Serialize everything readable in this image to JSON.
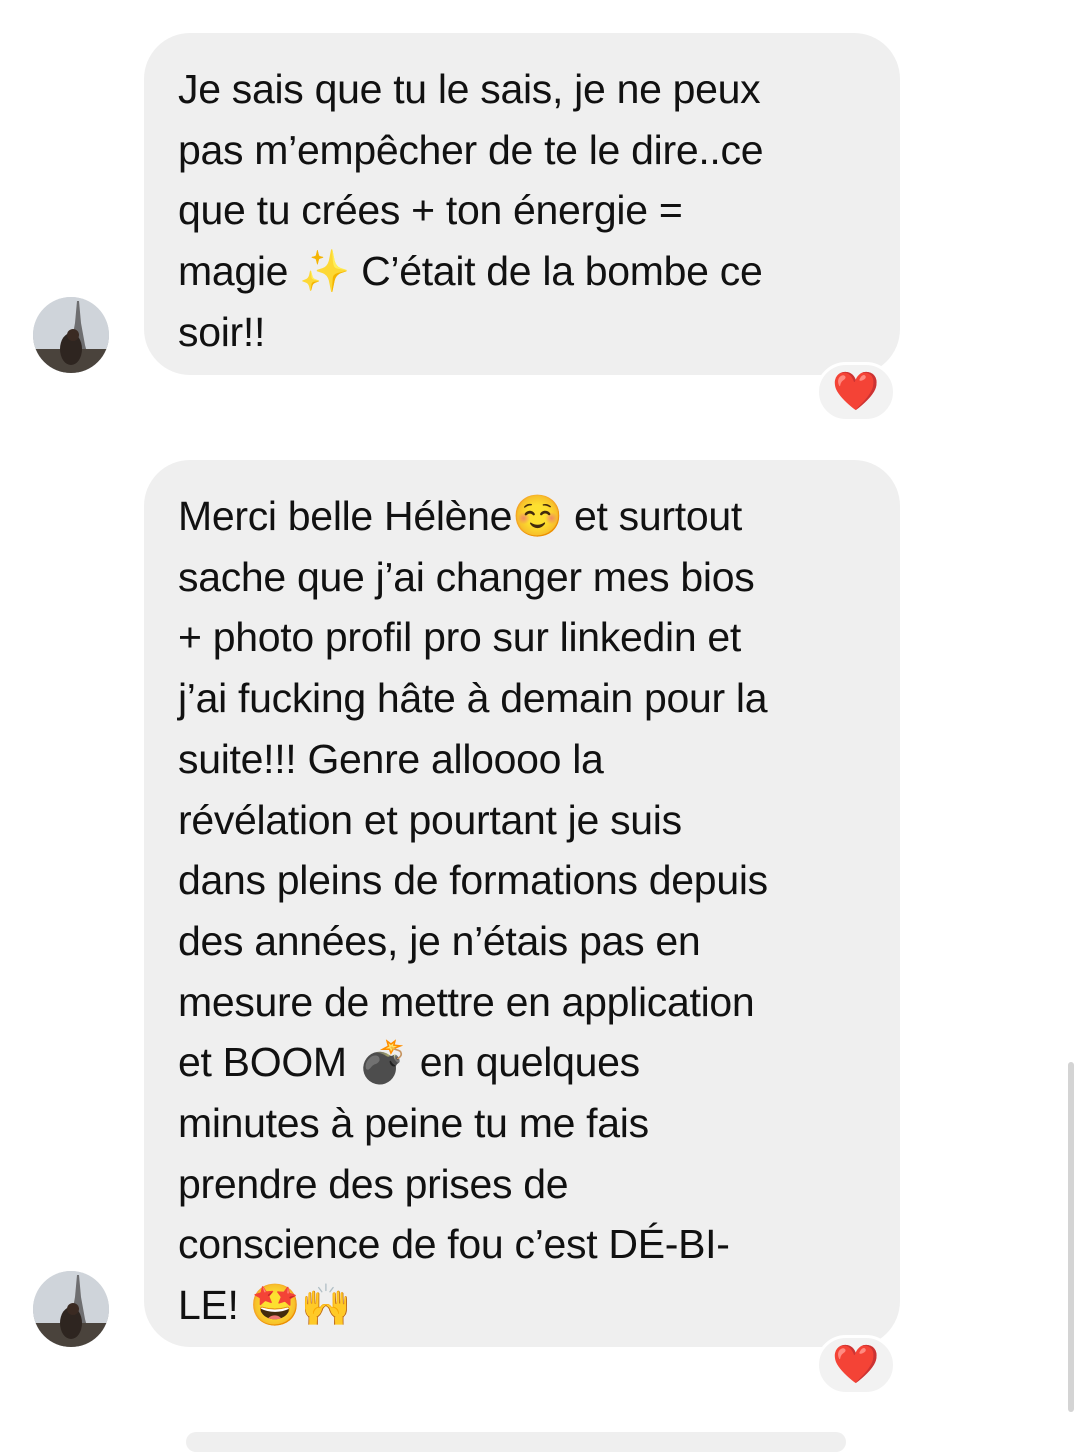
{
  "messages": [
    {
      "sender": "other",
      "text": "Je sais que tu le sais, je ne peux\npas m’empêcher de te le dire..ce\nque tu crées + ton énergie =\nmagie ✨ C’était de la bombe ce\nsoir!!",
      "reaction": "❤️"
    },
    {
      "sender": "other",
      "text": "Merci belle Hélène☺️ et surtout\nsache que j’ai changer mes bios\n+ photo profil pro sur linkedin et\nj’ai fucking hâte à demain pour la\nsuite!!! Genre alloooo la\nrévélation et pourtant je suis\ndans pleins de formations depuis\ndes années, je n’étais pas en\nmesure de mettre en application\net BOOM 💣 en quelques\nminutes à peine tu me fais\nprendre des prises de\nconscience de fou c’est DÉ-BI-\nLE! 🤩🙌",
      "reaction": "❤️"
    }
  ],
  "icons": {
    "avatar": "profile-photo-eiffel-tower",
    "reaction": "red-heart"
  },
  "colors": {
    "bubble": "#efefef",
    "text": "#111111",
    "reaction_heart": "#e0202f"
  }
}
